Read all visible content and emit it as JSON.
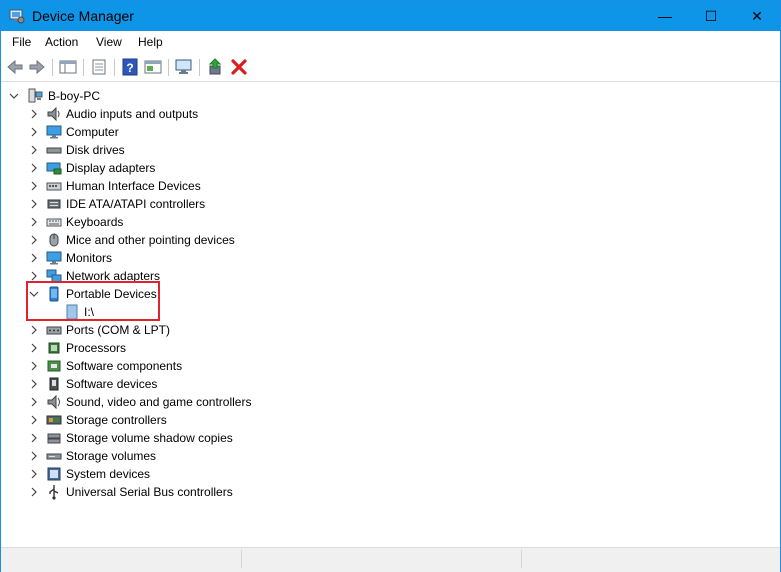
{
  "window": {
    "title": "Device Manager",
    "controls": {
      "minimize": "—",
      "maximize": "☐",
      "close": "✕"
    }
  },
  "menu": [
    "File",
    "Action",
    "View",
    "Help"
  ],
  "tree": {
    "root": "B-boy-PC",
    "items": [
      {
        "label": "Audio inputs and outputs",
        "icon": "speaker-icon",
        "expanded": false
      },
      {
        "label": "Computer",
        "icon": "computer-icon",
        "expanded": false
      },
      {
        "label": "Disk drives",
        "icon": "disk-drive-icon",
        "expanded": false
      },
      {
        "label": "Display adapters",
        "icon": "display-adapter-icon",
        "expanded": false
      },
      {
        "label": "Human Interface Devices",
        "icon": "hid-icon",
        "expanded": false
      },
      {
        "label": "IDE ATA/ATAPI controllers",
        "icon": "ide-controller-icon",
        "expanded": false
      },
      {
        "label": "Keyboards",
        "icon": "keyboard-icon",
        "expanded": false
      },
      {
        "label": "Mice and other pointing devices",
        "icon": "mouse-icon",
        "expanded": false
      },
      {
        "label": "Monitors",
        "icon": "monitor-icon",
        "expanded": false
      },
      {
        "label": "Network adapters",
        "icon": "network-adapter-icon",
        "expanded": false
      },
      {
        "label": "Portable Devices",
        "icon": "portable-device-icon",
        "expanded": true,
        "children": [
          "I:\\"
        ]
      },
      {
        "label": "Ports (COM & LPT)",
        "icon": "port-icon",
        "expanded": false
      },
      {
        "label": "Processors",
        "icon": "processor-icon",
        "expanded": false
      },
      {
        "label": "Software components",
        "icon": "software-component-icon",
        "expanded": false
      },
      {
        "label": "Software devices",
        "icon": "software-device-icon",
        "expanded": false
      },
      {
        "label": "Sound, video and game controllers",
        "icon": "sound-controller-icon",
        "expanded": false
      },
      {
        "label": "Storage controllers",
        "icon": "storage-controller-icon",
        "expanded": false
      },
      {
        "label": "Storage volume shadow copies",
        "icon": "shadow-copy-icon",
        "expanded": false
      },
      {
        "label": "Storage volumes",
        "icon": "storage-volume-icon",
        "expanded": false
      },
      {
        "label": "System devices",
        "icon": "system-device-icon",
        "expanded": false
      },
      {
        "label": "Universal Serial Bus controllers",
        "icon": "usb-controller-icon",
        "expanded": false
      }
    ]
  },
  "colors": {
    "titlebar": "#0f95e8",
    "highlight": "#e0232f",
    "selection": "#cce4f7"
  }
}
